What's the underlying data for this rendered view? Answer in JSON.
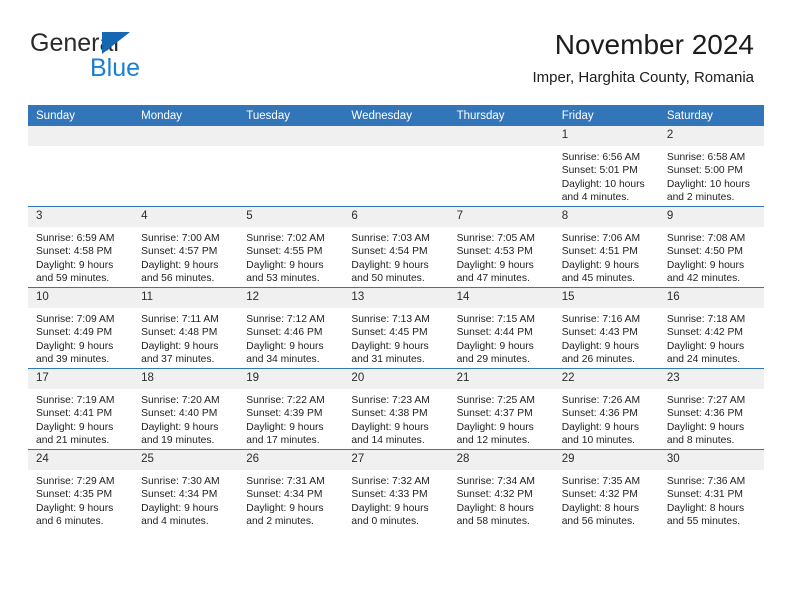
{
  "brand": {
    "name_top": "General",
    "name_bottom": "Blue",
    "accent_color": "#1567b2",
    "blue_text_color": "#1a7fd4"
  },
  "header": {
    "title": "November 2024",
    "subtitle": "Imper, Harghita County, Romania"
  },
  "theme": {
    "header_bar_color": "#3275b8",
    "daynum_band_color": "#f0f0f0",
    "cell_background": "#ffffff",
    "row_divider_color": "#3275b8",
    "text_color": "#1f1f1f"
  },
  "weekdays": [
    "Sunday",
    "Monday",
    "Tuesday",
    "Wednesday",
    "Thursday",
    "Friday",
    "Saturday"
  ],
  "labels": {
    "sunrise_prefix": "Sunrise:",
    "sunset_prefix": "Sunset:",
    "daylight_prefix": "Daylight:"
  },
  "weeks": [
    [
      {
        "day": "",
        "empty": true
      },
      {
        "day": "",
        "empty": true
      },
      {
        "day": "",
        "empty": true
      },
      {
        "day": "",
        "empty": true
      },
      {
        "day": "",
        "empty": true
      },
      {
        "day": "1",
        "sunrise": "Sunrise: 6:56 AM",
        "sunset": "Sunset: 5:01 PM",
        "daylight_1": "Daylight: 10 hours",
        "daylight_2": "and 4 minutes."
      },
      {
        "day": "2",
        "sunrise": "Sunrise: 6:58 AM",
        "sunset": "Sunset: 5:00 PM",
        "daylight_1": "Daylight: 10 hours",
        "daylight_2": "and 2 minutes."
      }
    ],
    [
      {
        "day": "3",
        "sunrise": "Sunrise: 6:59 AM",
        "sunset": "Sunset: 4:58 PM",
        "daylight_1": "Daylight: 9 hours",
        "daylight_2": "and 59 minutes."
      },
      {
        "day": "4",
        "sunrise": "Sunrise: 7:00 AM",
        "sunset": "Sunset: 4:57 PM",
        "daylight_1": "Daylight: 9 hours",
        "daylight_2": "and 56 minutes."
      },
      {
        "day": "5",
        "sunrise": "Sunrise: 7:02 AM",
        "sunset": "Sunset: 4:55 PM",
        "daylight_1": "Daylight: 9 hours",
        "daylight_2": "and 53 minutes."
      },
      {
        "day": "6",
        "sunrise": "Sunrise: 7:03 AM",
        "sunset": "Sunset: 4:54 PM",
        "daylight_1": "Daylight: 9 hours",
        "daylight_2": "and 50 minutes."
      },
      {
        "day": "7",
        "sunrise": "Sunrise: 7:05 AM",
        "sunset": "Sunset: 4:53 PM",
        "daylight_1": "Daylight: 9 hours",
        "daylight_2": "and 47 minutes."
      },
      {
        "day": "8",
        "sunrise": "Sunrise: 7:06 AM",
        "sunset": "Sunset: 4:51 PM",
        "daylight_1": "Daylight: 9 hours",
        "daylight_2": "and 45 minutes."
      },
      {
        "day": "9",
        "sunrise": "Sunrise: 7:08 AM",
        "sunset": "Sunset: 4:50 PM",
        "daylight_1": "Daylight: 9 hours",
        "daylight_2": "and 42 minutes."
      }
    ],
    [
      {
        "day": "10",
        "sunrise": "Sunrise: 7:09 AM",
        "sunset": "Sunset: 4:49 PM",
        "daylight_1": "Daylight: 9 hours",
        "daylight_2": "and 39 minutes."
      },
      {
        "day": "11",
        "sunrise": "Sunrise: 7:11 AM",
        "sunset": "Sunset: 4:48 PM",
        "daylight_1": "Daylight: 9 hours",
        "daylight_2": "and 37 minutes."
      },
      {
        "day": "12",
        "sunrise": "Sunrise: 7:12 AM",
        "sunset": "Sunset: 4:46 PM",
        "daylight_1": "Daylight: 9 hours",
        "daylight_2": "and 34 minutes."
      },
      {
        "day": "13",
        "sunrise": "Sunrise: 7:13 AM",
        "sunset": "Sunset: 4:45 PM",
        "daylight_1": "Daylight: 9 hours",
        "daylight_2": "and 31 minutes."
      },
      {
        "day": "14",
        "sunrise": "Sunrise: 7:15 AM",
        "sunset": "Sunset: 4:44 PM",
        "daylight_1": "Daylight: 9 hours",
        "daylight_2": "and 29 minutes."
      },
      {
        "day": "15",
        "sunrise": "Sunrise: 7:16 AM",
        "sunset": "Sunset: 4:43 PM",
        "daylight_1": "Daylight: 9 hours",
        "daylight_2": "and 26 minutes."
      },
      {
        "day": "16",
        "sunrise": "Sunrise: 7:18 AM",
        "sunset": "Sunset: 4:42 PM",
        "daylight_1": "Daylight: 9 hours",
        "daylight_2": "and 24 minutes."
      }
    ],
    [
      {
        "day": "17",
        "sunrise": "Sunrise: 7:19 AM",
        "sunset": "Sunset: 4:41 PM",
        "daylight_1": "Daylight: 9 hours",
        "daylight_2": "and 21 minutes."
      },
      {
        "day": "18",
        "sunrise": "Sunrise: 7:20 AM",
        "sunset": "Sunset: 4:40 PM",
        "daylight_1": "Daylight: 9 hours",
        "daylight_2": "and 19 minutes."
      },
      {
        "day": "19",
        "sunrise": "Sunrise: 7:22 AM",
        "sunset": "Sunset: 4:39 PM",
        "daylight_1": "Daylight: 9 hours",
        "daylight_2": "and 17 minutes."
      },
      {
        "day": "20",
        "sunrise": "Sunrise: 7:23 AM",
        "sunset": "Sunset: 4:38 PM",
        "daylight_1": "Daylight: 9 hours",
        "daylight_2": "and 14 minutes."
      },
      {
        "day": "21",
        "sunrise": "Sunrise: 7:25 AM",
        "sunset": "Sunset: 4:37 PM",
        "daylight_1": "Daylight: 9 hours",
        "daylight_2": "and 12 minutes."
      },
      {
        "day": "22",
        "sunrise": "Sunrise: 7:26 AM",
        "sunset": "Sunset: 4:36 PM",
        "daylight_1": "Daylight: 9 hours",
        "daylight_2": "and 10 minutes."
      },
      {
        "day": "23",
        "sunrise": "Sunrise: 7:27 AM",
        "sunset": "Sunset: 4:36 PM",
        "daylight_1": "Daylight: 9 hours",
        "daylight_2": "and 8 minutes."
      }
    ],
    [
      {
        "day": "24",
        "sunrise": "Sunrise: 7:29 AM",
        "sunset": "Sunset: 4:35 PM",
        "daylight_1": "Daylight: 9 hours",
        "daylight_2": "and 6 minutes."
      },
      {
        "day": "25",
        "sunrise": "Sunrise: 7:30 AM",
        "sunset": "Sunset: 4:34 PM",
        "daylight_1": "Daylight: 9 hours",
        "daylight_2": "and 4 minutes."
      },
      {
        "day": "26",
        "sunrise": "Sunrise: 7:31 AM",
        "sunset": "Sunset: 4:34 PM",
        "daylight_1": "Daylight: 9 hours",
        "daylight_2": "and 2 minutes."
      },
      {
        "day": "27",
        "sunrise": "Sunrise: 7:32 AM",
        "sunset": "Sunset: 4:33 PM",
        "daylight_1": "Daylight: 9 hours",
        "daylight_2": "and 0 minutes."
      },
      {
        "day": "28",
        "sunrise": "Sunrise: 7:34 AM",
        "sunset": "Sunset: 4:32 PM",
        "daylight_1": "Daylight: 8 hours",
        "daylight_2": "and 58 minutes."
      },
      {
        "day": "29",
        "sunrise": "Sunrise: 7:35 AM",
        "sunset": "Sunset: 4:32 PM",
        "daylight_1": "Daylight: 8 hours",
        "daylight_2": "and 56 minutes."
      },
      {
        "day": "30",
        "sunrise": "Sunrise: 7:36 AM",
        "sunset": "Sunset: 4:31 PM",
        "daylight_1": "Daylight: 8 hours",
        "daylight_2": "and 55 minutes."
      }
    ]
  ]
}
